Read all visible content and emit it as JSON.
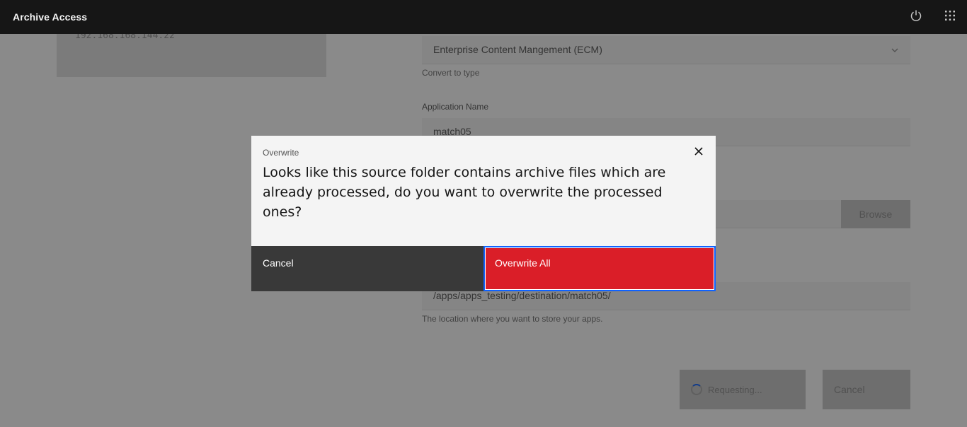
{
  "header": {
    "title": "Archive Access",
    "icons": [
      "power-icon",
      "app-switcher-icon"
    ]
  },
  "background": {
    "server_ip": "192.168.168.144.22",
    "convert_type_value": "Enterprise Content Mangement (ECM)",
    "convert_type_helper": "Convert to type",
    "app_name_label": "Application Name",
    "app_name_value": "match05",
    "browse_label": "Browse",
    "destination_value": "/apps/apps_testing/destination/match05/",
    "destination_helper": "The location where you want to store your apps.",
    "requesting_label": "Requesting...",
    "cancel_label": "Cancel"
  },
  "modal": {
    "label": "Overwrite",
    "heading": "Looks like this source folder contains archive files which are already processed, do you want to overwrite the processed ones?",
    "cancel_label": "Cancel",
    "confirm_label": "Overwrite All"
  },
  "colors": {
    "header_bg": "#161616",
    "danger": "#da1e28",
    "secondary": "#393939",
    "focus": "#0f62fe"
  }
}
